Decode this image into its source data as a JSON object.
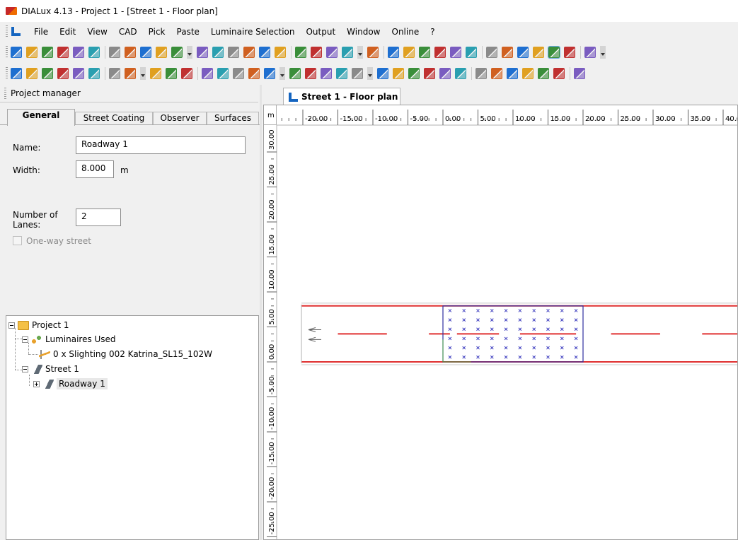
{
  "window": {
    "title": "DIALux 4.13 - Project 1 - [Street 1 - Floor plan]"
  },
  "menu": {
    "items": [
      "File",
      "Edit",
      "View",
      "CAD",
      "Pick",
      "Paste",
      "Luminaire Selection",
      "Output",
      "Window",
      "Online",
      "?"
    ]
  },
  "toolbars": {
    "row1": [
      "new-icon",
      "open-icon",
      "save-icon",
      "print-icon",
      "print-preview-icon",
      "pdf-icon",
      "cut-icon",
      "copy-icon",
      "paste-icon",
      "undo-icon",
      "redo-icon",
      "dropdown",
      "cube-icon",
      "floor-plan-icon",
      "front-view-icon",
      "side-view-icon",
      "3d-view-icon",
      "zoom-window-icon",
      "tool-a-icon",
      "tool-b-icon",
      "tool-c-icon",
      "tool-d-icon",
      "dropdown",
      "rotate-view-icon",
      "walk-icon",
      "light-bulb-icon",
      "tool-e-icon",
      "tool-f-icon",
      "tool-g-icon",
      "lamp-icon",
      "sphere-icon",
      "measure-icon",
      "paint-icon",
      "grid-icon",
      "grid-selected-icon",
      "grid-2-icon",
      "dxf-icon",
      "dropdown"
    ],
    "row2": [
      "select-a-icon",
      "select-b-icon",
      "select-c-icon",
      "select-d-icon",
      "select-e-icon",
      "select-f-icon",
      "select-g-icon",
      "select-h-icon",
      "dropdown",
      "calc-a-icon",
      "calc-b-icon",
      "calc-c-icon",
      "calc-dxf-icon",
      "calc-d-icon",
      "calc-e-icon",
      "calc-f-icon",
      "calc-g-icon",
      "dropdown",
      "pointer-icon",
      "zoom-icon",
      "orbit-icon",
      "pan-icon",
      "fly-icon",
      "dropdown",
      "paint-bucket-icon",
      "layers-icon",
      "tool-h-icon",
      "tool-i-icon",
      "tool-j-icon",
      "tool-k-icon",
      "tool-l-icon",
      "tool-m-icon",
      "tool-n-icon",
      "tool-o-icon",
      "tool-p-icon",
      "tool-q-icon",
      "tool-r-icon"
    ]
  },
  "project_manager": {
    "title": "Project manager",
    "tabs": [
      "General",
      "Street Coating",
      "Observer",
      "Surfaces"
    ],
    "active_tab": "General",
    "fields": {
      "name_label": "Name:",
      "name_value": "Roadway 1",
      "width_label": "Width:",
      "width_value": "8.000",
      "width_unit": "m",
      "lanes_label": "Number of Lanes:",
      "lanes_value": "2",
      "oneway_label": "One-way street",
      "oneway_checked": false
    },
    "tree": {
      "project": "Project 1",
      "luminaires_used": "Luminaires Used",
      "luminaire": "0 x Slighting 002 Katrina_SL15_102W",
      "street": "Street 1",
      "roadway": "Roadway 1"
    }
  },
  "document": {
    "tab_label": "Street 1 - Floor plan",
    "ruler_unit": "m",
    "x_ticks": [
      "-20.00",
      "-15.00",
      "-10.00",
      "-5.00",
      "0.00",
      "5.00",
      "10.00",
      "15.00",
      "20.00",
      "25.00",
      "30.00",
      "35.00",
      "40.0"
    ],
    "y_ticks": [
      "30.00",
      "25.00",
      "20.00",
      "15.00",
      "10.00",
      "5.00",
      "0.00",
      "-5.00",
      "-10.00",
      "-15.00",
      "-20.00",
      "-25.00"
    ],
    "colors": {
      "road_edge": "#e03030",
      "lane_marking": "#e03030",
      "calc_grid": "#3030a0",
      "calc_marker": "#4040c0",
      "observer": "#40a040"
    }
  }
}
